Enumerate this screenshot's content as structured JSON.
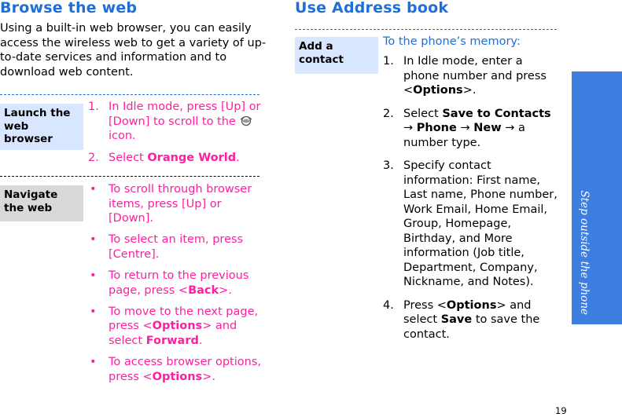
{
  "left": {
    "title": "Browse the web",
    "intro": "Using a built-in web browser, you can easily access the wireless web to get a variety of up-to-date services and information and to download web content.",
    "launch": {
      "tab": "Launch the web browser",
      "step1_num": "1.",
      "step1_pre": "In Idle mode, press [Up] or [Down] to scroll to the",
      "step1_post": "icon.",
      "step2_num": "2.",
      "step2_pre": "Select ",
      "step2_bold": "Orange World",
      "step2_post": "."
    },
    "navigate": {
      "tab": "Navigate the web",
      "b1": "To scroll through browser items, press [Up] or [Down].",
      "b2": "To select an item, press [Centre].",
      "b3_pre": "To return to the previous page, press <",
      "b3_bold": "Back",
      "b3_post": ">.",
      "b4_pre": "To move to the next page, press <",
      "b4_bold": "Options",
      "b4_mid": "> and select ",
      "b4_bold2": "Forward",
      "b4_post": ".",
      "b5_pre": "To access browser options, press <",
      "b5_bold": "Options",
      "b5_post": ">."
    }
  },
  "right": {
    "title": "Use Address book",
    "tab": "Add a contact",
    "subhead": "To the phone’s memory:",
    "s1_num": "1.",
    "s1_pre": "In Idle mode, enter a phone number and press <",
    "s1_bold": "Options",
    "s1_post": ">.",
    "s2_num": "2.",
    "s2_pre": "Select ",
    "s2_bold1": "Save to Contacts",
    "s2_arrow1": " → ",
    "s2_bold2": "Phone",
    "s2_arrow2": " → ",
    "s2_bold3": "New",
    "s2_post": " → a number type.",
    "s3_num": "3.",
    "s3_text": "Specify contact information: First name, Last name, Phone number, Work Email, Home Email, Group, Homepage, Birthday, and More information (Job title, Department, Company, Nickname, and Notes).",
    "s4_num": "4.",
    "s4_pre": "Press <",
    "s4_bold1": "Options",
    "s4_mid": "> and select ",
    "s4_bold2": "Save",
    "s4_post": " to save the contact."
  },
  "side_tab": "Step outside the phone",
  "page_number": "19",
  "colors": {
    "accent": "#1e6fd9",
    "highlight": "#ff1fa0",
    "sidebar": "#3d7ee0"
  },
  "icons": {
    "browser_icon": "orange-world-icon"
  }
}
